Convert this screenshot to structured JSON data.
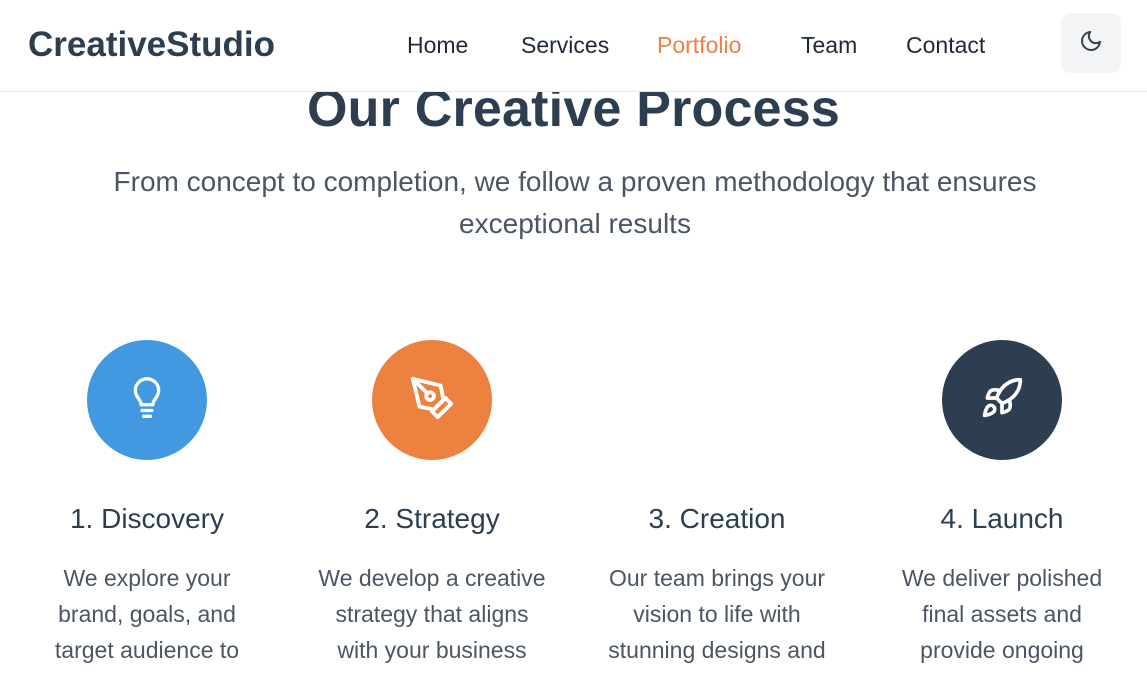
{
  "header": {
    "logo": "CreativeStudio",
    "nav": [
      {
        "label": "Home",
        "active": false
      },
      {
        "label": "Services",
        "active": false
      },
      {
        "label": "Portfolio",
        "active": true
      },
      {
        "label": "Team",
        "active": false
      },
      {
        "label": "Contact",
        "active": false
      }
    ],
    "theme_toggle_icon": "moon-icon"
  },
  "process": {
    "title": "Our Creative Process",
    "subtitle": "From concept to completion, we follow a proven methodology that ensures exceptional results",
    "steps": [
      {
        "title": "1. Discovery",
        "desc_lines": [
          "We explore your",
          "brand, goals, and",
          "target audience to"
        ],
        "icon": "lightbulb-icon",
        "color": "#4299e1"
      },
      {
        "title": "2. Strategy",
        "desc_lines": [
          "We develop a creative",
          "strategy that aligns",
          "with your business"
        ],
        "icon": "pen-tool-icon",
        "color": "#ed8140"
      },
      {
        "title": "3. Creation",
        "desc_lines": [
          "Our team brings your",
          "vision to life with",
          "stunning designs and"
        ],
        "icon": "",
        "color": ""
      },
      {
        "title": "4. Launch",
        "desc_lines": [
          "We deliver polished",
          "final assets and",
          "provide ongoing"
        ],
        "icon": "rocket-icon",
        "color": "#2d3e50"
      }
    ]
  },
  "colors": {
    "accent": "#ed8140",
    "heading": "#2c3e50",
    "body_text": "#4b5563"
  }
}
